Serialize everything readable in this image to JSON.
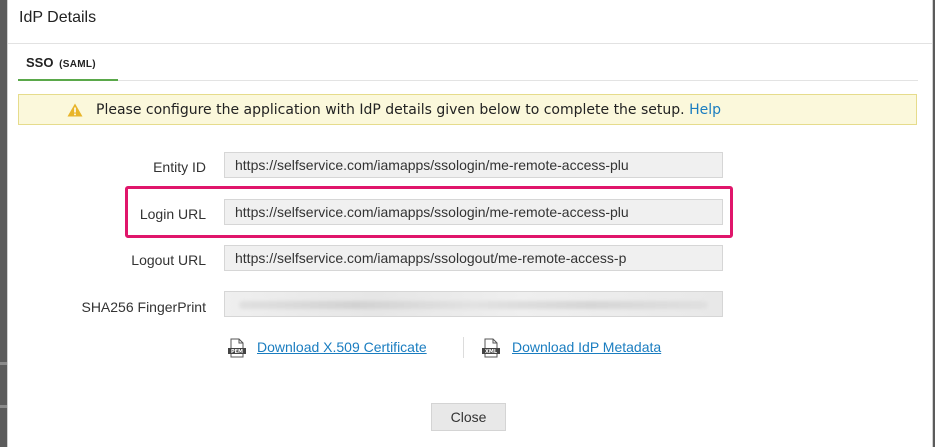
{
  "dialog": {
    "title": "IdP Details",
    "tab": {
      "label": "SSO",
      "sublabel": "(SAML)",
      "accent_color": "#5aa84a"
    }
  },
  "alert": {
    "icon": "warning-icon",
    "message": "Please configure the application with IdP details given below to complete the setup.",
    "help_link": "Help"
  },
  "fields": {
    "entity_id": {
      "label": "Entity ID",
      "value": "https://selfservice.com/iamapps/ssologin/me-remote-access-plu"
    },
    "login_url": {
      "label": "Login URL",
      "value": "https://selfservice.com/iamapps/ssologin/me-remote-access-plu",
      "highlight_color": "#e0166b"
    },
    "logout_url": {
      "label": "Logout URL",
      "value": "https://selfservice.com/iamapps/ssologout/me-remote-access-p"
    },
    "sha256": {
      "label": "SHA256 FingerPrint",
      "value": ""
    }
  },
  "downloads": {
    "certificate": {
      "label": "Download X.509 Certificate",
      "icon": "pem-file-icon",
      "badge": "PEM"
    },
    "metadata": {
      "label": "Download IdP Metadata",
      "icon": "xml-file-icon",
      "badge": "XML"
    }
  },
  "footer": {
    "close_label": "Close"
  }
}
